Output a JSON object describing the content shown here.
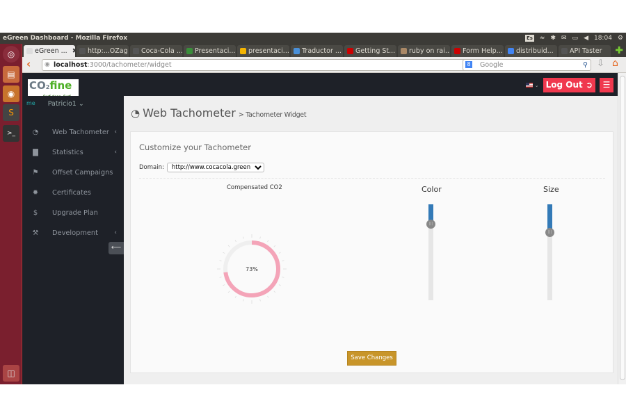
{
  "os": {
    "window_title": "eGreen Dashboard - Mozilla Firefox",
    "keyboard_layout": "Es",
    "clock": "18:04",
    "launcher": [
      "ubuntu-dash-icon",
      "files-icon",
      "firefox-icon",
      "sublime-text-icon",
      "terminal-icon",
      "trash-icon"
    ]
  },
  "browser": {
    "tabs": [
      {
        "label": "eGreen ...",
        "active": true,
        "fav": "#ddd"
      },
      {
        "label": "http:...OZag",
        "fav": "#555"
      },
      {
        "label": "Coca-Cola ...",
        "fav": "#555"
      },
      {
        "label": "Presentaci...",
        "fav": "#3a8e3a"
      },
      {
        "label": "presentaci...",
        "fav": "#f4b400"
      },
      {
        "label": "Traductor ...",
        "fav": "#4a90d9"
      },
      {
        "label": "Getting St...",
        "fav": "#c00"
      },
      {
        "label": "ruby on rai...",
        "fav": "#a86"
      },
      {
        "label": "Form Help...",
        "fav": "#c00"
      },
      {
        "label": "distribuid...",
        "fav": "#4285f4"
      },
      {
        "label": "API Taster",
        "fav": "#555"
      }
    ],
    "url_host": "localhost",
    "url_rest": ":3000/tachometer/widget",
    "search_placeholder": "Google"
  },
  "app": {
    "logo_main": "CO",
    "logo_sub": "2",
    "logo_accent": "fine",
    "logo_tagline": "Surf clean. Surf green.",
    "user": "Patricio1 ⌄",
    "user_badge": "me",
    "logout_label": "Log Out",
    "accent_color": "#f0384e",
    "sidebar": [
      {
        "label": "Web Tachometer",
        "icon": "◔",
        "chevron": "‹"
      },
      {
        "label": "Statistics",
        "icon": "▇",
        "chevron": "‹"
      },
      {
        "label": "Offset Campaigns",
        "icon": "⚑",
        "chevron": ""
      },
      {
        "label": "Certificates",
        "icon": "✹",
        "chevron": ""
      },
      {
        "label": "Upgrade Plan",
        "icon": "$",
        "chevron": ""
      },
      {
        "label": "Development",
        "icon": "⚒",
        "chevron": "‹"
      }
    ],
    "page_title": "Web Tachometer",
    "page_subtitle": "> Tachometer Widget",
    "panel_title": "Customize your Tachometer",
    "domain_label": "Domain:",
    "domain_value": "http://www.cocacola.green",
    "gauge_label": "Compensated CO2",
    "gauge_value_text": "73%",
    "gauge_value": 0.73,
    "gauge_color": "#f4a4b8",
    "color_label": "Color",
    "color_slider_value": 0.2,
    "size_label": "Size",
    "size_slider_value": 0.29,
    "save_label": "Save Changes"
  }
}
